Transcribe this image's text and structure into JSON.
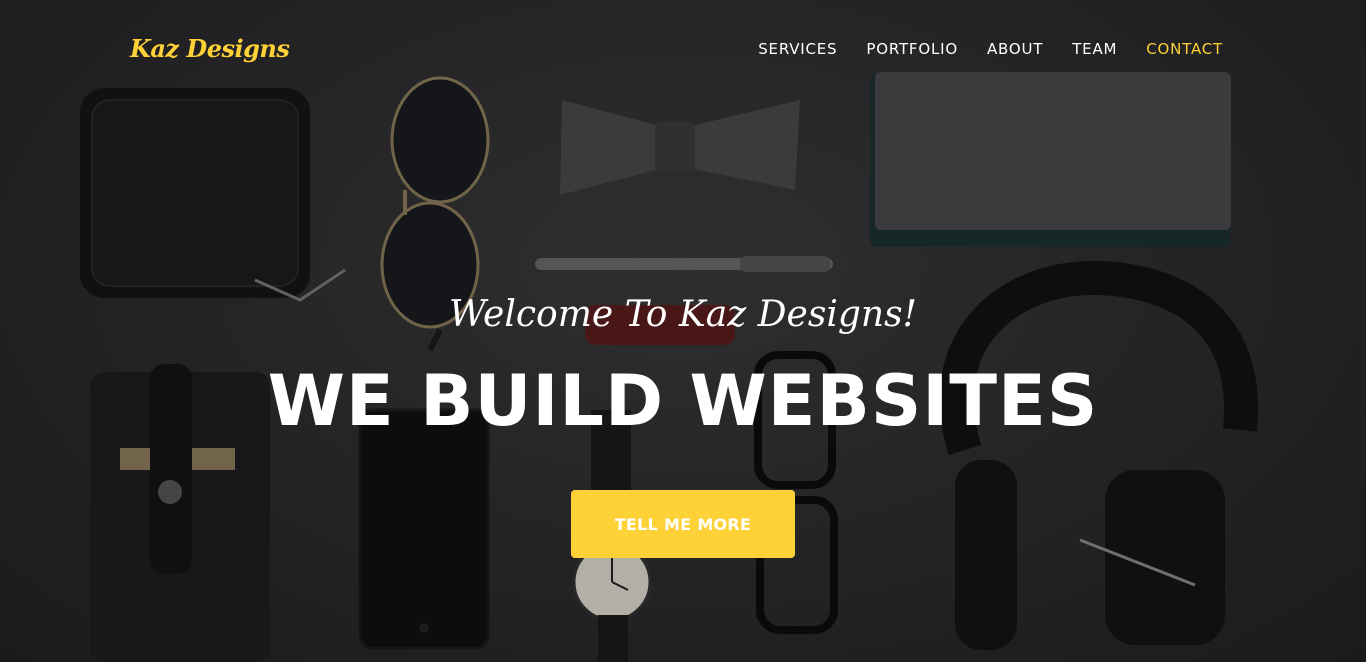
{
  "brand": {
    "name": "Kaz Designs"
  },
  "nav": {
    "items": [
      {
        "label": "SERVICES"
      },
      {
        "label": "PORTFOLIO"
      },
      {
        "label": "ABOUT"
      },
      {
        "label": "TEAM"
      },
      {
        "label": "CONTACT"
      }
    ],
    "active_item": "CONTACT"
  },
  "hero": {
    "subtitle": "Welcome To Kaz Designs!",
    "headline": "WE BUILD WEBSITES",
    "cta_label": "TELL ME MORE",
    "background_image": "flat-lay-accessories-dark"
  },
  "colors": {
    "accent": "#fed136",
    "text": "#ffffff",
    "background": "#2b2a2c"
  }
}
